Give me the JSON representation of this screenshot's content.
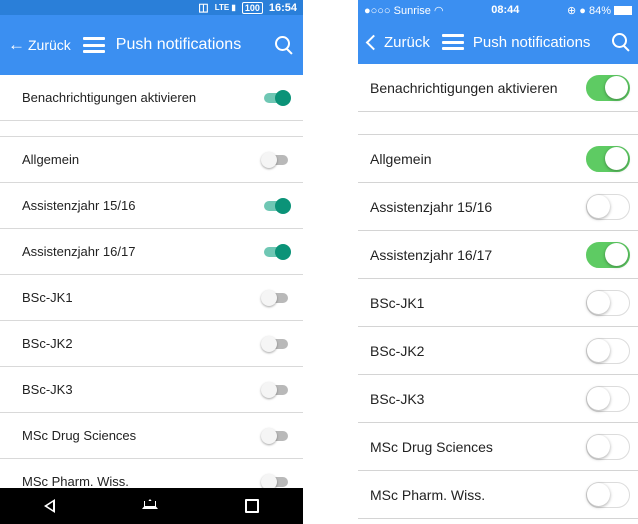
{
  "android": {
    "status": {
      "lte": "LTE",
      "battery": "100",
      "time": "16:54"
    },
    "header": {
      "back_label": "Zurück",
      "title": "Push notifications"
    },
    "enable": {
      "label": "Benachrichtigungen aktivieren",
      "on": true
    },
    "items": [
      {
        "label": "Allgemein",
        "on": false
      },
      {
        "label": "Assistenzjahr 15/16",
        "on": true
      },
      {
        "label": "Assistenzjahr 16/17",
        "on": true
      },
      {
        "label": "BSc-JK1",
        "on": false
      },
      {
        "label": "BSc-JK2",
        "on": false
      },
      {
        "label": "BSc-JK3",
        "on": false
      },
      {
        "label": "MSc Drug Sciences",
        "on": false
      },
      {
        "label": "MSc Pharm. Wiss.",
        "on": false
      }
    ]
  },
  "ios": {
    "status": {
      "carrier": "●○○○ Sunrise",
      "time": "08:44",
      "battery": "84%"
    },
    "header": {
      "back_label": "Zurück",
      "title": "Push notifications"
    },
    "enable": {
      "label": "Benachrichtigungen aktivieren",
      "on": true
    },
    "items": [
      {
        "label": "Allgemein",
        "on": true
      },
      {
        "label": "Assistenzjahr 15/16",
        "on": false
      },
      {
        "label": "Assistenzjahr 16/17",
        "on": true
      },
      {
        "label": "BSc-JK1",
        "on": false
      },
      {
        "label": "BSc-JK2",
        "on": false
      },
      {
        "label": "BSc-JK3",
        "on": false
      },
      {
        "label": "MSc Drug Sciences",
        "on": false
      },
      {
        "label": "MSc Pharm. Wiss.",
        "on": false
      }
    ]
  },
  "colors": {
    "header": "#3b8ff1",
    "android_switch_on": "#0b9378",
    "ios_switch_on": "#5ecb63"
  }
}
